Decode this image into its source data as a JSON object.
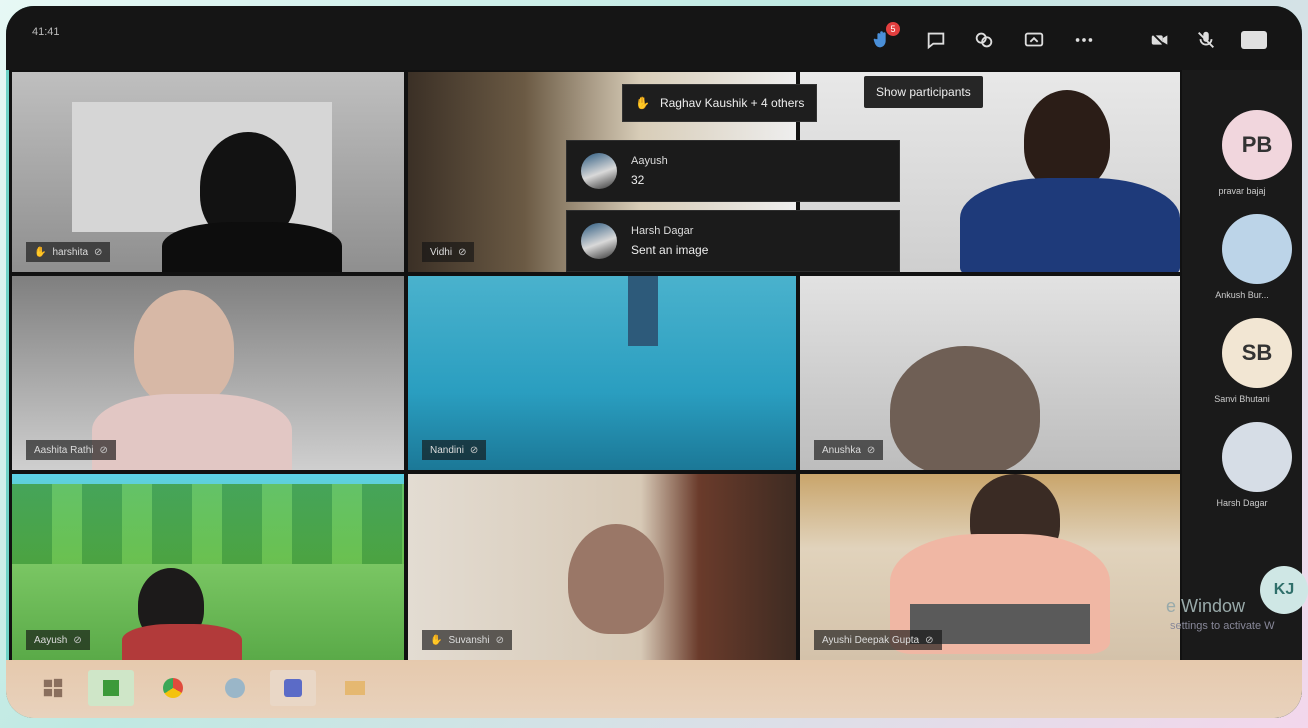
{
  "meeting": {
    "time": "41:41",
    "participant_badge": "5",
    "tooltip": "Show participants",
    "raised_hands": "Raghav Kaushik + 4 others"
  },
  "notifications": [
    {
      "name": "Aayush",
      "message": "32"
    },
    {
      "name": "Harsh Dagar",
      "message": "Sent an image"
    }
  ],
  "tiles": [
    {
      "label": "harshita"
    },
    {
      "label": "Vidhi"
    },
    {
      "label": ""
    },
    {
      "label": "Aashita Rathi"
    },
    {
      "label": "Nandini"
    },
    {
      "label": "Anushka"
    },
    {
      "label": "Aayush"
    },
    {
      "label": "Suvanshi"
    },
    {
      "label": "Ayushi Deepak Gupta"
    }
  ],
  "participants_rail": [
    {
      "initials": "PB",
      "name": "pravar bajaj",
      "color": "#f1d6dd"
    },
    {
      "initials": "",
      "name": "Ankush Bur...",
      "color": "#bcd4e8"
    },
    {
      "initials": "SB",
      "name": "Sanvi Bhutani",
      "color": "#f2e6d3"
    },
    {
      "initials": "",
      "name": "Harsh Dagar",
      "color": "#d6dde6"
    }
  ],
  "corner_avatar": {
    "initials": "KJ"
  },
  "watermark": {
    "line1": "e Window",
    "line2": "settings to activate W"
  },
  "colors": {
    "accent": "#6fd2c6",
    "badge": "#e23e3e"
  }
}
